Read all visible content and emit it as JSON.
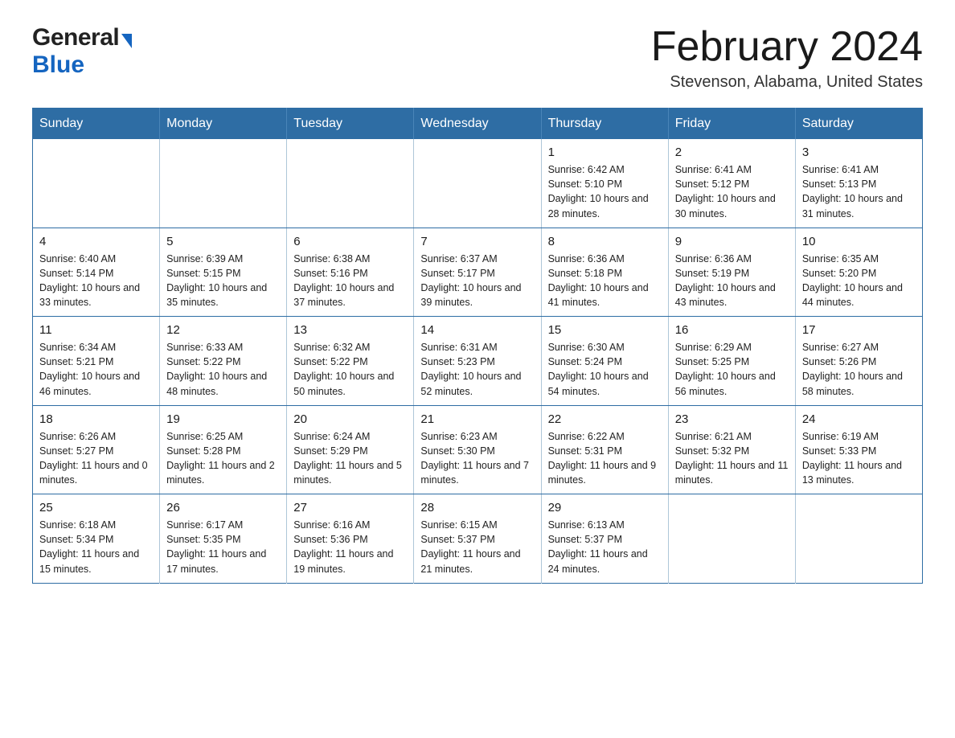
{
  "header": {
    "logo_general": "General",
    "logo_blue": "Blue",
    "month_title": "February 2024",
    "location": "Stevenson, Alabama, United States"
  },
  "days_of_week": [
    "Sunday",
    "Monday",
    "Tuesday",
    "Wednesday",
    "Thursday",
    "Friday",
    "Saturday"
  ],
  "weeks": [
    [
      {
        "day": "",
        "info": ""
      },
      {
        "day": "",
        "info": ""
      },
      {
        "day": "",
        "info": ""
      },
      {
        "day": "",
        "info": ""
      },
      {
        "day": "1",
        "info": "Sunrise: 6:42 AM\nSunset: 5:10 PM\nDaylight: 10 hours and 28 minutes."
      },
      {
        "day": "2",
        "info": "Sunrise: 6:41 AM\nSunset: 5:12 PM\nDaylight: 10 hours and 30 minutes."
      },
      {
        "day": "3",
        "info": "Sunrise: 6:41 AM\nSunset: 5:13 PM\nDaylight: 10 hours and 31 minutes."
      }
    ],
    [
      {
        "day": "4",
        "info": "Sunrise: 6:40 AM\nSunset: 5:14 PM\nDaylight: 10 hours and 33 minutes."
      },
      {
        "day": "5",
        "info": "Sunrise: 6:39 AM\nSunset: 5:15 PM\nDaylight: 10 hours and 35 minutes."
      },
      {
        "day": "6",
        "info": "Sunrise: 6:38 AM\nSunset: 5:16 PM\nDaylight: 10 hours and 37 minutes."
      },
      {
        "day": "7",
        "info": "Sunrise: 6:37 AM\nSunset: 5:17 PM\nDaylight: 10 hours and 39 minutes."
      },
      {
        "day": "8",
        "info": "Sunrise: 6:36 AM\nSunset: 5:18 PM\nDaylight: 10 hours and 41 minutes."
      },
      {
        "day": "9",
        "info": "Sunrise: 6:36 AM\nSunset: 5:19 PM\nDaylight: 10 hours and 43 minutes."
      },
      {
        "day": "10",
        "info": "Sunrise: 6:35 AM\nSunset: 5:20 PM\nDaylight: 10 hours and 44 minutes."
      }
    ],
    [
      {
        "day": "11",
        "info": "Sunrise: 6:34 AM\nSunset: 5:21 PM\nDaylight: 10 hours and 46 minutes."
      },
      {
        "day": "12",
        "info": "Sunrise: 6:33 AM\nSunset: 5:22 PM\nDaylight: 10 hours and 48 minutes."
      },
      {
        "day": "13",
        "info": "Sunrise: 6:32 AM\nSunset: 5:22 PM\nDaylight: 10 hours and 50 minutes."
      },
      {
        "day": "14",
        "info": "Sunrise: 6:31 AM\nSunset: 5:23 PM\nDaylight: 10 hours and 52 minutes."
      },
      {
        "day": "15",
        "info": "Sunrise: 6:30 AM\nSunset: 5:24 PM\nDaylight: 10 hours and 54 minutes."
      },
      {
        "day": "16",
        "info": "Sunrise: 6:29 AM\nSunset: 5:25 PM\nDaylight: 10 hours and 56 minutes."
      },
      {
        "day": "17",
        "info": "Sunrise: 6:27 AM\nSunset: 5:26 PM\nDaylight: 10 hours and 58 minutes."
      }
    ],
    [
      {
        "day": "18",
        "info": "Sunrise: 6:26 AM\nSunset: 5:27 PM\nDaylight: 11 hours and 0 minutes."
      },
      {
        "day": "19",
        "info": "Sunrise: 6:25 AM\nSunset: 5:28 PM\nDaylight: 11 hours and 2 minutes."
      },
      {
        "day": "20",
        "info": "Sunrise: 6:24 AM\nSunset: 5:29 PM\nDaylight: 11 hours and 5 minutes."
      },
      {
        "day": "21",
        "info": "Sunrise: 6:23 AM\nSunset: 5:30 PM\nDaylight: 11 hours and 7 minutes."
      },
      {
        "day": "22",
        "info": "Sunrise: 6:22 AM\nSunset: 5:31 PM\nDaylight: 11 hours and 9 minutes."
      },
      {
        "day": "23",
        "info": "Sunrise: 6:21 AM\nSunset: 5:32 PM\nDaylight: 11 hours and 11 minutes."
      },
      {
        "day": "24",
        "info": "Sunrise: 6:19 AM\nSunset: 5:33 PM\nDaylight: 11 hours and 13 minutes."
      }
    ],
    [
      {
        "day": "25",
        "info": "Sunrise: 6:18 AM\nSunset: 5:34 PM\nDaylight: 11 hours and 15 minutes."
      },
      {
        "day": "26",
        "info": "Sunrise: 6:17 AM\nSunset: 5:35 PM\nDaylight: 11 hours and 17 minutes."
      },
      {
        "day": "27",
        "info": "Sunrise: 6:16 AM\nSunset: 5:36 PM\nDaylight: 11 hours and 19 minutes."
      },
      {
        "day": "28",
        "info": "Sunrise: 6:15 AM\nSunset: 5:37 PM\nDaylight: 11 hours and 21 minutes."
      },
      {
        "day": "29",
        "info": "Sunrise: 6:13 AM\nSunset: 5:37 PM\nDaylight: 11 hours and 24 minutes."
      },
      {
        "day": "",
        "info": ""
      },
      {
        "day": "",
        "info": ""
      }
    ]
  ]
}
